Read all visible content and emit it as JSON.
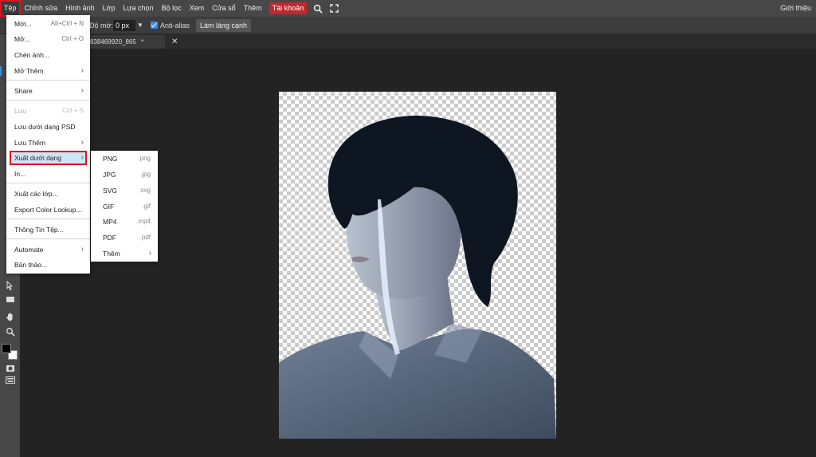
{
  "menubar": {
    "items": [
      "Tệp",
      "Chỉnh sửa",
      "Hình ảnh",
      "Lớp",
      "Lựa chọn",
      "Bộ lọc",
      "Xem",
      "Cửa sổ",
      "Thêm"
    ],
    "account": "Tài khoản",
    "search_icon": "search-icon",
    "fullscreen_icon": "fullscreen-icon",
    "right": "Giới thiệu"
  },
  "options": {
    "feather_label": "Độ mờ:",
    "feather_value": "0 px",
    "antialias_label": "Anti-alias",
    "refine_button": "Làm láng cạnh"
  },
  "tab": {
    "title": "838469920_865",
    "modified": "*",
    "close": "✕"
  },
  "file_menu": {
    "new": {
      "label": "Mới...",
      "shortcut": "Alt+Ctrl + N"
    },
    "open": {
      "label": "Mở...",
      "shortcut": "Ctrl + O"
    },
    "insert": {
      "label": "Chèn ảnh..."
    },
    "open_more": {
      "label": "Mở Thêm"
    },
    "share": {
      "label": "Share"
    },
    "save": {
      "label": "Lưu",
      "shortcut": "Ctrl + S"
    },
    "save_psd": {
      "label": "Lưu dưới dạng PSD"
    },
    "save_more": {
      "label": "Lưu Thêm"
    },
    "export_as": {
      "label": "Xuất dưới dạng"
    },
    "print": {
      "label": "In..."
    },
    "export_layers": {
      "label": "Xuất các lớp..."
    },
    "export_lut": {
      "label": "Export Color Lookup..."
    },
    "file_info": {
      "label": "Thông Tin Tệp..."
    },
    "automate": {
      "label": "Automate"
    },
    "scripts": {
      "label": "Bản thảo..."
    }
  },
  "export_menu": {
    "items": [
      {
        "label": "PNG",
        "ext": ".png"
      },
      {
        "label": "JPG",
        "ext": ".jpg"
      },
      {
        "label": "SVG",
        "ext": ".svg"
      },
      {
        "label": "GIF",
        "ext": ".gif"
      },
      {
        "label": "MP4",
        "ext": ".mp4"
      },
      {
        "label": "PDF",
        "ext": ".pdf"
      }
    ],
    "more": "Thêm"
  },
  "colors": {
    "accent": "#3b8de0",
    "highlight_outline": "#e0141e",
    "account_bg": "#c1272d",
    "foreground_swatch": "#000000",
    "background_swatch": "#ffffff"
  }
}
